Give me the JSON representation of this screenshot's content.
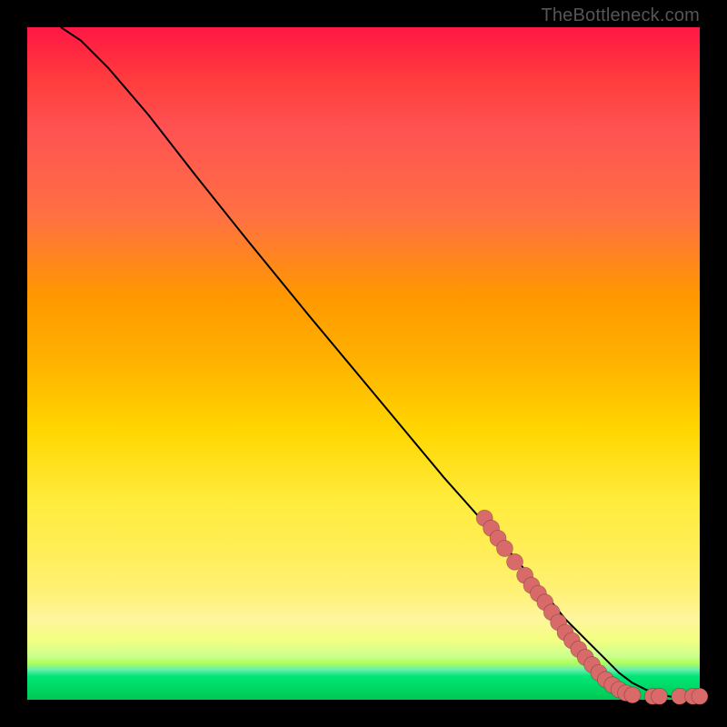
{
  "watermark": "TheBottleneck.com",
  "colors": {
    "dot": "#d86a6a",
    "curve": "#000000",
    "frame": "#000000"
  },
  "chart_data": {
    "type": "line",
    "title": "",
    "xlabel": "",
    "ylabel": "",
    "xlim": [
      0,
      100
    ],
    "ylim": [
      0,
      100
    ],
    "grid": false,
    "legend": false,
    "series": [
      {
        "name": "bottleneck-curve",
        "x": [
          5,
          8,
          12,
          18,
          25,
          33,
          42,
          52,
          62,
          70,
          76,
          80,
          83,
          86,
          88,
          90,
          92,
          94,
          96,
          98,
          100
        ],
        "y": [
          100,
          98,
          94,
          87,
          78,
          68,
          57,
          45,
          33,
          24,
          17,
          12,
          9,
          6,
          4,
          2.5,
          1.5,
          0.8,
          0.4,
          0.2,
          0.1
        ]
      }
    ],
    "points": [
      {
        "name": "marker",
        "x": 68,
        "y": 27
      },
      {
        "name": "marker",
        "x": 69,
        "y": 25.5
      },
      {
        "name": "marker",
        "x": 70,
        "y": 24
      },
      {
        "name": "marker",
        "x": 71,
        "y": 22.5
      },
      {
        "name": "marker",
        "x": 72.5,
        "y": 20.5
      },
      {
        "name": "marker",
        "x": 74,
        "y": 18.5
      },
      {
        "name": "marker",
        "x": 75,
        "y": 17
      },
      {
        "name": "marker",
        "x": 76,
        "y": 15.8
      },
      {
        "name": "marker",
        "x": 77,
        "y": 14.5
      },
      {
        "name": "marker",
        "x": 78,
        "y": 13
      },
      {
        "name": "marker",
        "x": 79,
        "y": 11.5
      },
      {
        "name": "marker",
        "x": 80,
        "y": 10
      },
      {
        "name": "marker",
        "x": 81,
        "y": 8.8
      },
      {
        "name": "marker",
        "x": 82,
        "y": 7.5
      },
      {
        "name": "marker",
        "x": 83,
        "y": 6.3
      },
      {
        "name": "marker",
        "x": 84,
        "y": 5.2
      },
      {
        "name": "marker",
        "x": 85,
        "y": 4
      },
      {
        "name": "marker",
        "x": 86,
        "y": 3
      },
      {
        "name": "marker",
        "x": 87,
        "y": 2.2
      },
      {
        "name": "marker",
        "x": 88,
        "y": 1.5
      },
      {
        "name": "marker",
        "x": 89,
        "y": 1
      },
      {
        "name": "marker",
        "x": 90,
        "y": 0.7
      },
      {
        "name": "marker",
        "x": 93,
        "y": 0.5
      },
      {
        "name": "marker",
        "x": 94,
        "y": 0.5
      },
      {
        "name": "marker",
        "x": 97,
        "y": 0.5
      },
      {
        "name": "marker",
        "x": 99,
        "y": 0.5
      },
      {
        "name": "marker",
        "x": 100,
        "y": 0.5
      }
    ]
  }
}
